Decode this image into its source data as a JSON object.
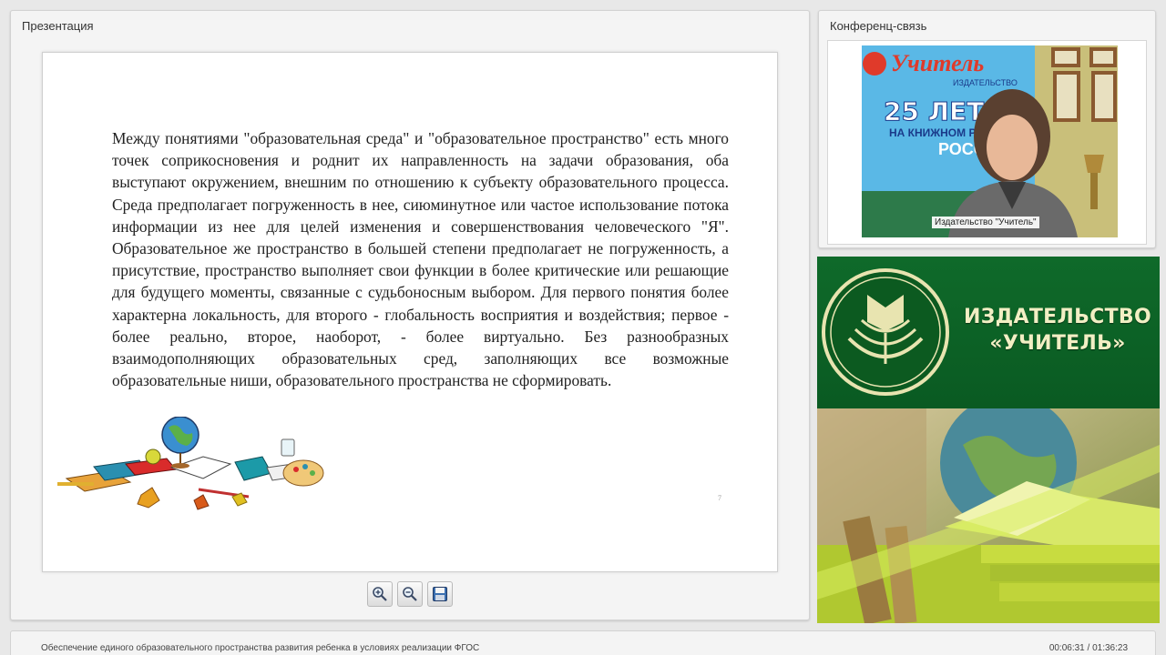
{
  "presentation": {
    "title": "Презентация",
    "slide": {
      "text": "Между понятиями \"образовательная среда\" и \"образовательное пространство\" есть много точек соприкосновения и роднит их направленность на задачи образования, оба выступают окружением, внешним по отношению к субъекту образовательного процесса. Среда предполагает погруженность в нее, сиюминутное или частое использование потока информации из нее для целей изменения и совершенствования человеческого \"Я\". Образовательное же пространство в большей степени предполагает не погруженность, а присутствие, пространство выполняет свои функции в более критические или решающие для будущего моменты, связанные с судьбоносным выбором. Для первого понятия более характерна локальность, для второго - глобальность восприятия и воздействия; первое - более реально, второе, наоборот, - более виртуально. Без разнообразных взаимодополняющих образовательных сред, заполняющих все возможные образовательные ниши, образовательного пространства не сформировать.",
      "number": "7"
    },
    "toolbar": {
      "zoom_in_icon": "zoom-in-icon",
      "zoom_out_icon": "zoom-out-icon",
      "save_icon": "save-icon"
    }
  },
  "conference": {
    "title": "Конференц-связь",
    "speaker_caption": "Издательство \"Учитель\"",
    "backdrop_poster": {
      "brand": "Учитель",
      "sub": "ИЗДАТЕЛЬСТВО",
      "years": "25 ЛЕТ",
      "line": "НА КНИЖНОМ Р",
      "line2": "РОСС"
    }
  },
  "banner": {
    "publisher_line1": "ИЗДАТЕЛЬСТВО",
    "publisher_line2": "«УЧИТЕЛЬ»",
    "colors": {
      "green": "#0f6a2a",
      "lime": "#a8d43a",
      "cream": "#f2efc4"
    }
  },
  "footer": {
    "course_title": "Обеспечение единого образовательного пространства развития ребенка в условиях реализации ФГОС",
    "timecode": "00:06:31 / 01:36:23"
  }
}
